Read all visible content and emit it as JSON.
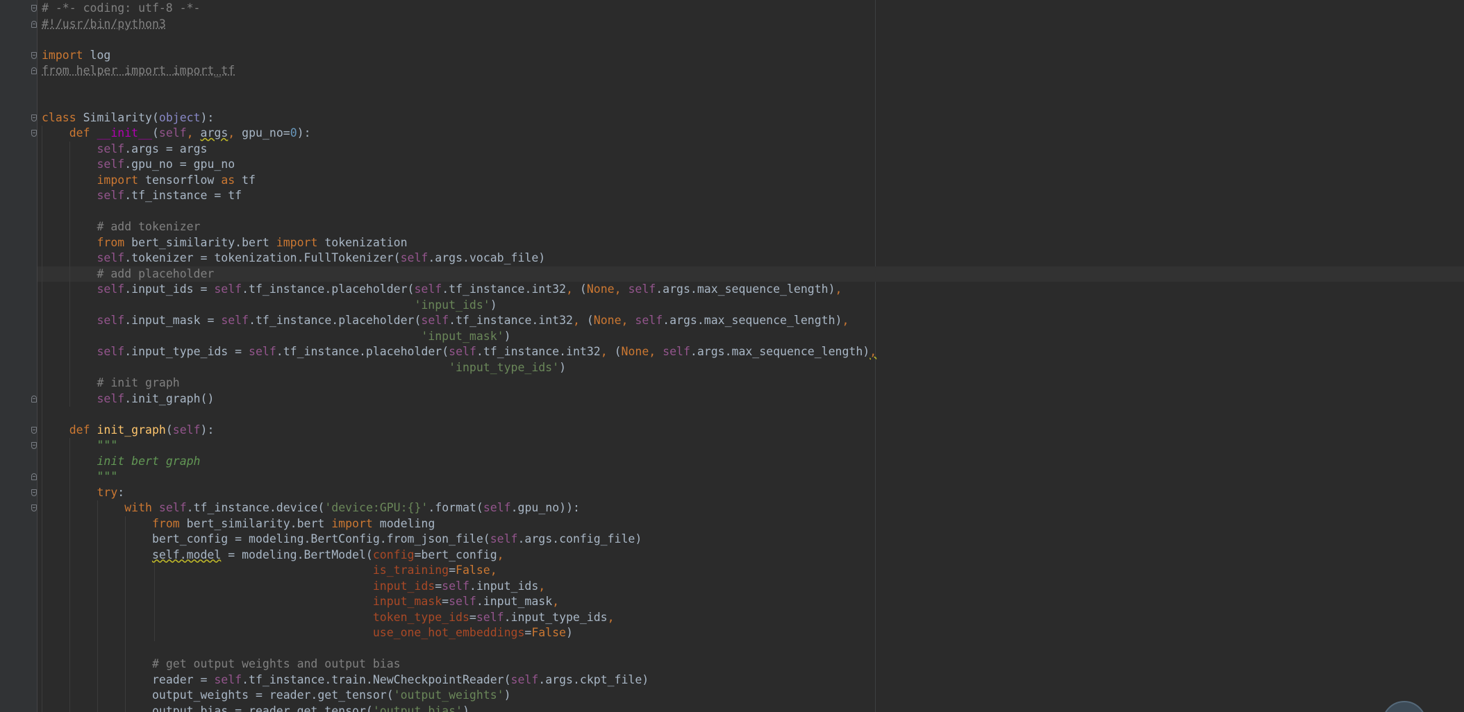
{
  "editor": {
    "language": "python",
    "colors": {
      "background": "#2b2b2b",
      "gutter": "#313335",
      "text": "#a9b7c6",
      "keyword": "#cc7832",
      "self": "#94558d",
      "number": "#6897bb",
      "string": "#6a8759",
      "comment": "#808080",
      "docstring": "#629755",
      "function": "#ffc66d",
      "magic": "#b200b2",
      "kwarg": "#aa4926",
      "builtin": "#8888c6"
    },
    "current_line": 17,
    "lines": [
      {
        "n": 0,
        "tokens": [
          {
            "t": "# -*- coding: utf-8 -*-",
            "c": "cmt"
          }
        ],
        "fold": "start"
      },
      {
        "n": 1,
        "tokens": [
          {
            "t": "#!/usr/bin/python3",
            "c": "cmt under"
          }
        ],
        "fold": "end"
      },
      {
        "n": 3,
        "tokens": [
          {
            "t": "import",
            "c": "kw"
          },
          {
            "t": " log",
            "c": ""
          }
        ],
        "fold": "start"
      },
      {
        "n": 4,
        "tokens": [
          {
            "t": "from helper import import_tf",
            "c": "cmt under"
          }
        ],
        "fold": "end"
      },
      {
        "n": 7,
        "tokens": [
          {
            "t": "class",
            "c": "kw"
          },
          {
            "t": " Similarity(",
            "c": ""
          },
          {
            "t": "object",
            "c": "builtin"
          },
          {
            "t": "):",
            "c": ""
          }
        ],
        "fold": "start"
      },
      {
        "n": 8,
        "tokens": [
          {
            "t": "    ",
            "c": ""
          },
          {
            "t": "def",
            "c": "kw"
          },
          {
            "t": " ",
            "c": ""
          },
          {
            "t": "__init__",
            "c": "magic"
          },
          {
            "t": "(",
            "c": ""
          },
          {
            "t": "self",
            "c": "self"
          },
          {
            "t": ", ",
            "c": "kw"
          },
          {
            "t": "args",
            "c": "warn"
          },
          {
            "t": ", ",
            "c": "kw"
          },
          {
            "t": "gpu_no=",
            "c": ""
          },
          {
            "t": "0",
            "c": "num"
          },
          {
            "t": "):",
            "c": ""
          }
        ],
        "fold": "start"
      },
      {
        "n": 9,
        "tokens": [
          {
            "t": "        ",
            "c": ""
          },
          {
            "t": "self",
            "c": "self"
          },
          {
            "t": ".args = args",
            "c": ""
          }
        ]
      },
      {
        "n": 10,
        "tokens": [
          {
            "t": "        ",
            "c": ""
          },
          {
            "t": "self",
            "c": "self"
          },
          {
            "t": ".gpu_no = gpu_no",
            "c": ""
          }
        ]
      },
      {
        "n": 11,
        "tokens": [
          {
            "t": "        ",
            "c": ""
          },
          {
            "t": "import",
            "c": "kw"
          },
          {
            "t": " tensorflow ",
            "c": ""
          },
          {
            "t": "as",
            "c": "kw"
          },
          {
            "t": " tf",
            "c": ""
          }
        ]
      },
      {
        "n": 12,
        "tokens": [
          {
            "t": "        ",
            "c": ""
          },
          {
            "t": "self",
            "c": "self"
          },
          {
            "t": ".tf_instance = tf",
            "c": ""
          }
        ]
      },
      {
        "n": 14,
        "tokens": [
          {
            "t": "        ",
            "c": ""
          },
          {
            "t": "# add tokenizer",
            "c": "cmt"
          }
        ]
      },
      {
        "n": 15,
        "tokens": [
          {
            "t": "        ",
            "c": ""
          },
          {
            "t": "from",
            "c": "kw"
          },
          {
            "t": " bert_similarity.bert ",
            "c": ""
          },
          {
            "t": "import",
            "c": "kw"
          },
          {
            "t": " tokenization",
            "c": ""
          }
        ]
      },
      {
        "n": 16,
        "tokens": [
          {
            "t": "        ",
            "c": ""
          },
          {
            "t": "self",
            "c": "self"
          },
          {
            "t": ".tokenizer = tokenization.FullTokenizer(",
            "c": ""
          },
          {
            "t": "self",
            "c": "self"
          },
          {
            "t": ".args.vocab_file)",
            "c": ""
          }
        ]
      },
      {
        "n": 17,
        "tokens": [
          {
            "t": "        ",
            "c": ""
          },
          {
            "t": "# add placeholder",
            "c": "cmt"
          }
        ]
      },
      {
        "n": 18,
        "tokens": [
          {
            "t": "        ",
            "c": ""
          },
          {
            "t": "self",
            "c": "self"
          },
          {
            "t": ".input_ids = ",
            "c": ""
          },
          {
            "t": "self",
            "c": "self"
          },
          {
            "t": ".tf_instance.placeholder(",
            "c": ""
          },
          {
            "t": "self",
            "c": "self"
          },
          {
            "t": ".tf_instance.int32",
            "c": ""
          },
          {
            "t": ", ",
            "c": "kw"
          },
          {
            "t": "(",
            "c": ""
          },
          {
            "t": "None",
            "c": "kw"
          },
          {
            "t": ", ",
            "c": "kw"
          },
          {
            "t": "self",
            "c": "self"
          },
          {
            "t": ".args.max_sequence_length)",
            "c": ""
          },
          {
            "t": ",",
            "c": "kw"
          }
        ]
      },
      {
        "n": 19,
        "tokens": [
          {
            "t": "                                                      ",
            "c": ""
          },
          {
            "t": "'input_ids'",
            "c": "str"
          },
          {
            "t": ")",
            "c": ""
          }
        ]
      },
      {
        "n": 20,
        "tokens": [
          {
            "t": "        ",
            "c": ""
          },
          {
            "t": "self",
            "c": "self"
          },
          {
            "t": ".input_mask = ",
            "c": ""
          },
          {
            "t": "self",
            "c": "self"
          },
          {
            "t": ".tf_instance.placeholder(",
            "c": ""
          },
          {
            "t": "self",
            "c": "self"
          },
          {
            "t": ".tf_instance.int32",
            "c": ""
          },
          {
            "t": ", ",
            "c": "kw"
          },
          {
            "t": "(",
            "c": ""
          },
          {
            "t": "None",
            "c": "kw"
          },
          {
            "t": ", ",
            "c": "kw"
          },
          {
            "t": "self",
            "c": "self"
          },
          {
            "t": ".args.max_sequence_length)",
            "c": ""
          },
          {
            "t": ",",
            "c": "kw"
          }
        ]
      },
      {
        "n": 21,
        "tokens": [
          {
            "t": "                                                       ",
            "c": ""
          },
          {
            "t": "'input_mask'",
            "c": "str"
          },
          {
            "t": ")",
            "c": ""
          }
        ]
      },
      {
        "n": 22,
        "tokens": [
          {
            "t": "        ",
            "c": ""
          },
          {
            "t": "self",
            "c": "self"
          },
          {
            "t": ".input_type_ids = ",
            "c": ""
          },
          {
            "t": "self",
            "c": "self"
          },
          {
            "t": ".tf_instance.placeholder(",
            "c": ""
          },
          {
            "t": "self",
            "c": "self"
          },
          {
            "t": ".tf_instance.int32",
            "c": ""
          },
          {
            "t": ", ",
            "c": "kw"
          },
          {
            "t": "(",
            "c": ""
          },
          {
            "t": "None",
            "c": "kw"
          },
          {
            "t": ", ",
            "c": "kw"
          },
          {
            "t": "self",
            "c": "self"
          },
          {
            "t": ".args.max_sequence_length)",
            "c": ""
          },
          {
            "t": ",",
            "c": "kw warn"
          }
        ]
      },
      {
        "n": 23,
        "tokens": [
          {
            "t": "                                                           ",
            "c": ""
          },
          {
            "t": "'input_type_ids'",
            "c": "str"
          },
          {
            "t": ")",
            "c": ""
          }
        ]
      },
      {
        "n": 24,
        "tokens": [
          {
            "t": "        ",
            "c": ""
          },
          {
            "t": "# init graph",
            "c": "cmt"
          }
        ]
      },
      {
        "n": 25,
        "tokens": [
          {
            "t": "        ",
            "c": ""
          },
          {
            "t": "self",
            "c": "self"
          },
          {
            "t": ".init_graph()",
            "c": ""
          }
        ],
        "fold": "end"
      },
      {
        "n": 27,
        "tokens": [
          {
            "t": "    ",
            "c": ""
          },
          {
            "t": "def",
            "c": "kw"
          },
          {
            "t": " ",
            "c": ""
          },
          {
            "t": "init_graph",
            "c": "fn"
          },
          {
            "t": "(",
            "c": ""
          },
          {
            "t": "self",
            "c": "self"
          },
          {
            "t": "):",
            "c": ""
          }
        ],
        "fold": "start"
      },
      {
        "n": 28,
        "tokens": [
          {
            "t": "        ",
            "c": ""
          },
          {
            "t": "\"\"\"",
            "c": "doc"
          }
        ],
        "fold": "start"
      },
      {
        "n": 29,
        "tokens": [
          {
            "t": "        ",
            "c": ""
          },
          {
            "t": "init bert graph",
            "c": "doc"
          }
        ]
      },
      {
        "n": 30,
        "tokens": [
          {
            "t": "        ",
            "c": ""
          },
          {
            "t": "\"\"\"",
            "c": "doc"
          }
        ],
        "fold": "end"
      },
      {
        "n": 31,
        "tokens": [
          {
            "t": "        ",
            "c": ""
          },
          {
            "t": "try",
            "c": "kw"
          },
          {
            "t": ":",
            "c": ""
          }
        ],
        "fold": "start"
      },
      {
        "n": 32,
        "tokens": [
          {
            "t": "            ",
            "c": ""
          },
          {
            "t": "with",
            "c": "kw"
          },
          {
            "t": " ",
            "c": ""
          },
          {
            "t": "self",
            "c": "self"
          },
          {
            "t": ".tf_instance.device(",
            "c": ""
          },
          {
            "t": "'device:GPU:{}'",
            "c": "str"
          },
          {
            "t": ".format(",
            "c": ""
          },
          {
            "t": "self",
            "c": "self"
          },
          {
            "t": ".gpu_no)):",
            "c": ""
          }
        ],
        "fold": "start"
      },
      {
        "n": 33,
        "tokens": [
          {
            "t": "                ",
            "c": ""
          },
          {
            "t": "from",
            "c": "kw"
          },
          {
            "t": " bert_similarity.bert ",
            "c": ""
          },
          {
            "t": "import",
            "c": "kw"
          },
          {
            "t": " modeling",
            "c": ""
          }
        ]
      },
      {
        "n": 34,
        "tokens": [
          {
            "t": "                ",
            "c": ""
          },
          {
            "t": "bert_config = modeling.BertConfig.from_json_file(",
            "c": ""
          },
          {
            "t": "self",
            "c": "self"
          },
          {
            "t": ".args.config_file)",
            "c": ""
          }
        ]
      },
      {
        "n": 35,
        "tokens": [
          {
            "t": "                ",
            "c": ""
          },
          {
            "t": "self.model",
            "c": "warn"
          },
          {
            "t": " = modeling.BertModel(",
            "c": ""
          },
          {
            "t": "config",
            "c": "param"
          },
          {
            "t": "=bert_config",
            "c": ""
          },
          {
            "t": ",",
            "c": "kw"
          }
        ]
      },
      {
        "n": 36,
        "tokens": [
          {
            "t": "                                                ",
            "c": ""
          },
          {
            "t": "is_training",
            "c": "param"
          },
          {
            "t": "=",
            "c": ""
          },
          {
            "t": "False",
            "c": "kw"
          },
          {
            "t": ",",
            "c": "kw"
          }
        ]
      },
      {
        "n": 37,
        "tokens": [
          {
            "t": "                                                ",
            "c": ""
          },
          {
            "t": "input_ids",
            "c": "param"
          },
          {
            "t": "=",
            "c": ""
          },
          {
            "t": "self",
            "c": "self"
          },
          {
            "t": ".input_ids",
            "c": ""
          },
          {
            "t": ",",
            "c": "kw"
          }
        ]
      },
      {
        "n": 38,
        "tokens": [
          {
            "t": "                                                ",
            "c": ""
          },
          {
            "t": "input_mask",
            "c": "param"
          },
          {
            "t": "=",
            "c": ""
          },
          {
            "t": "self",
            "c": "self"
          },
          {
            "t": ".input_mask",
            "c": ""
          },
          {
            "t": ",",
            "c": "kw"
          }
        ]
      },
      {
        "n": 39,
        "tokens": [
          {
            "t": "                                                ",
            "c": ""
          },
          {
            "t": "token_type_ids",
            "c": "param"
          },
          {
            "t": "=",
            "c": ""
          },
          {
            "t": "self",
            "c": "self"
          },
          {
            "t": ".input_type_ids",
            "c": ""
          },
          {
            "t": ",",
            "c": "kw"
          }
        ]
      },
      {
        "n": 40,
        "tokens": [
          {
            "t": "                                                ",
            "c": ""
          },
          {
            "t": "use_one_hot_embeddings",
            "c": "param"
          },
          {
            "t": "=",
            "c": ""
          },
          {
            "t": "False",
            "c": "kw"
          },
          {
            "t": ")",
            "c": ""
          }
        ]
      },
      {
        "n": 42,
        "tokens": [
          {
            "t": "                ",
            "c": ""
          },
          {
            "t": "# get output weights and output bias",
            "c": "cmt"
          }
        ]
      },
      {
        "n": 43,
        "tokens": [
          {
            "t": "                ",
            "c": ""
          },
          {
            "t": "reader = ",
            "c": ""
          },
          {
            "t": "self",
            "c": "self"
          },
          {
            "t": ".tf_instance.train.NewCheckpointReader(",
            "c": ""
          },
          {
            "t": "self",
            "c": "self"
          },
          {
            "t": ".args.ckpt_file)",
            "c": ""
          }
        ]
      },
      {
        "n": 44,
        "tokens": [
          {
            "t": "                ",
            "c": ""
          },
          {
            "t": "output_weights = reader.get_tensor(",
            "c": ""
          },
          {
            "t": "'output_weights'",
            "c": "str"
          },
          {
            "t": ")",
            "c": ""
          }
        ]
      },
      {
        "n": 45,
        "tokens": [
          {
            "t": "                ",
            "c": ""
          },
          {
            "t": "output_bias = reader.get_tensor(",
            "c": ""
          },
          {
            "t": "'output_bias'",
            "c": "str"
          },
          {
            "t": ")",
            "c": ""
          }
        ]
      }
    ]
  }
}
